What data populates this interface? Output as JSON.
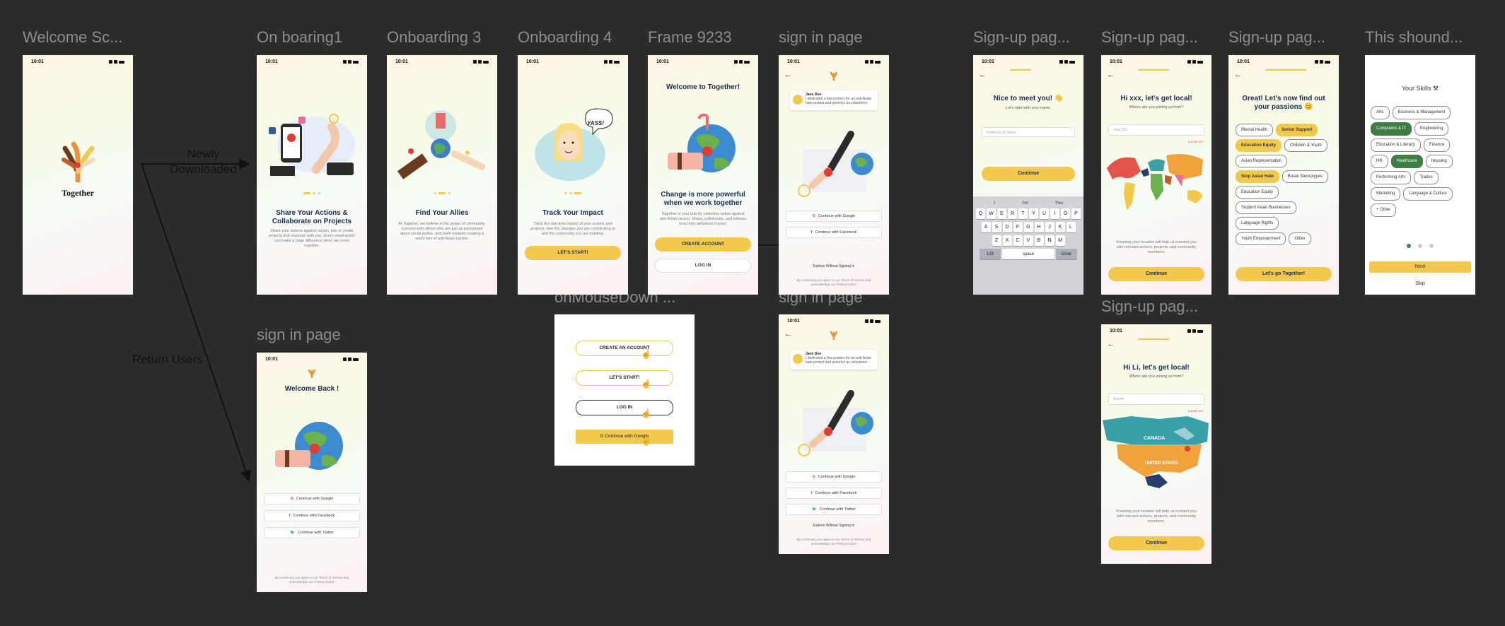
{
  "status_time": "10:01",
  "frame_titles": {
    "welcome": "Welcome Sc...",
    "onboarding1": "On boaring1",
    "onboarding3": "Onboarding 3",
    "onboarding4": "Onboarding 4",
    "frame9233": "Frame 9233",
    "signin1": "sign in page",
    "signup1": "Sign-up pag...",
    "signup2": "Sign-up pag...",
    "signup3": "Sign-up pag...",
    "skills": "This shound...",
    "signin_return": "sign in page",
    "mousedown": "onMouseDown ...",
    "signin2": "sign in page",
    "signup4": "Sign-up pag..."
  },
  "flow_labels": {
    "newly": "Newly\nDownloaded",
    "return": "Return Users"
  },
  "welcome": {
    "logo_text": "Together"
  },
  "onboarding1": {
    "title": "Share Your Actions & Collaborate on Projects",
    "body": "Share your actions against racism, join or create projects that resonate with you. Every small action can make a huge difference when we come together."
  },
  "onboarding3": {
    "title": "Find Your Allies",
    "body": "At Together, we believe in the power of community. Connect with others who are just as passionate about social justice, and work towards creating a world free of anti-Asian racism."
  },
  "onboarding4": {
    "bubble": "YASS!",
    "title": "Track Your Impact",
    "body": "Track the real-time impact of your actions and projects. See the changes you are contributing to and the community you are building.",
    "cta": "LET'S START!"
  },
  "frame9233": {
    "title": "Welcome to Together!",
    "subtitle": "Change is more powerful when we work together",
    "body": "Together is your hub for collective action against anti-Asian racism. Share, collaborate, and witness how unity advances impact.",
    "create": "CREATE ACCOUNT",
    "login": "LOG IN"
  },
  "signin": {
    "card_name": "Jane Doe",
    "card_text": "I dedicated a few posters for an anti-Asian hate protest and joined in as volunteers.",
    "google": "Continue with Google",
    "facebook": "Continue with Facebook",
    "twitter": "Continue with Twitter",
    "explore": "Explore Without Signing In",
    "terms": "By continuing you agree to our Terms of Service and acknowledge our Privacy Notice"
  },
  "signin_return": {
    "title": "Welcome Back !"
  },
  "signup1": {
    "title": "Nice to meet you! 👋",
    "sub": "Let's start with your name.",
    "placeholder": "Preferred ID Name",
    "cta": "Continue",
    "suggestions": [
      "I",
      "I'm",
      "You"
    ],
    "row1": [
      "Q",
      "W",
      "E",
      "R",
      "T",
      "Y",
      "U",
      "I",
      "O",
      "P"
    ],
    "row2": [
      "A",
      "S",
      "D",
      "F",
      "G",
      "H",
      "J",
      "K",
      "L"
    ],
    "row3": [
      "Z",
      "X",
      "C",
      "V",
      "B",
      "N",
      "M"
    ],
    "k123": "123",
    "space": "space",
    "enter": "Enter"
  },
  "signup2": {
    "title": "Hi xxx, let's get local!",
    "sub": "Where are you joining us from?",
    "placeholder": "Your City",
    "locate": "Locate me",
    "body": "Knowing your location will help us connect you with relevant actions, projects, and community members.",
    "cta": "Continue"
  },
  "signup3": {
    "title": "Great! Let's now find out your passions 😊",
    "chips": [
      {
        "label": "Mental Health",
        "sel": false
      },
      {
        "label": "Senior Support",
        "sel": true
      },
      {
        "label": "Education Equity",
        "sel": true
      },
      {
        "label": "Children & Youth",
        "sel": false
      },
      {
        "label": "Asian Representation",
        "sel": false
      },
      {
        "label": "Stop Asian Hate",
        "sel": true
      },
      {
        "label": "Break Stereotypes",
        "sel": false
      },
      {
        "label": "Education Equity",
        "sel": false
      },
      {
        "label": "Support Asian Businesses",
        "sel": false
      },
      {
        "label": "Language Rights",
        "sel": false
      },
      {
        "label": "Youth Empowerment",
        "sel": false
      },
      {
        "label": "Other",
        "sel": false
      }
    ],
    "cta": "Let's go Together!"
  },
  "skills": {
    "title": "Your Skills ⚒",
    "chips": [
      {
        "label": "Arts",
        "sel": false
      },
      {
        "label": "Business & Management",
        "sel": false
      },
      {
        "label": "Computers & IT",
        "sel": true
      },
      {
        "label": "Engineering",
        "sel": false
      },
      {
        "label": "Education & Literacy",
        "sel": false
      },
      {
        "label": "Finance",
        "sel": false
      },
      {
        "label": "HR",
        "sel": false
      },
      {
        "label": "Healthcare",
        "sel": true
      },
      {
        "label": "Housing",
        "sel": false
      },
      {
        "label": "Performing Arts",
        "sel": false
      },
      {
        "label": "Trades",
        "sel": false
      },
      {
        "label": "Marketing",
        "sel": false
      },
      {
        "label": "Language & Culture",
        "sel": false
      },
      {
        "label": "+ Other",
        "sel": false
      }
    ],
    "next": "Next",
    "skip": "Skip"
  },
  "mousedown": {
    "create": "CREATE AN ACCOUNT",
    "start": "LET'S START!",
    "login": "LOG IN",
    "google": "Continue with Google"
  },
  "signup4": {
    "title": "Hi Li, let's get local!",
    "sub": "Where are you joining us from?",
    "placeholder": "Boston",
    "locate": "Locate me",
    "canada": "CANADA",
    "us": "UNITED STATES",
    "body": "Knowing your location will help us connect you with relevant actions, projects, and community members.",
    "cta": "Continue"
  },
  "colors": {
    "accent": "#f2c94c",
    "navy": "#1d2c4d",
    "green": "#3f7d45",
    "canvas": "#2c2c2c"
  }
}
